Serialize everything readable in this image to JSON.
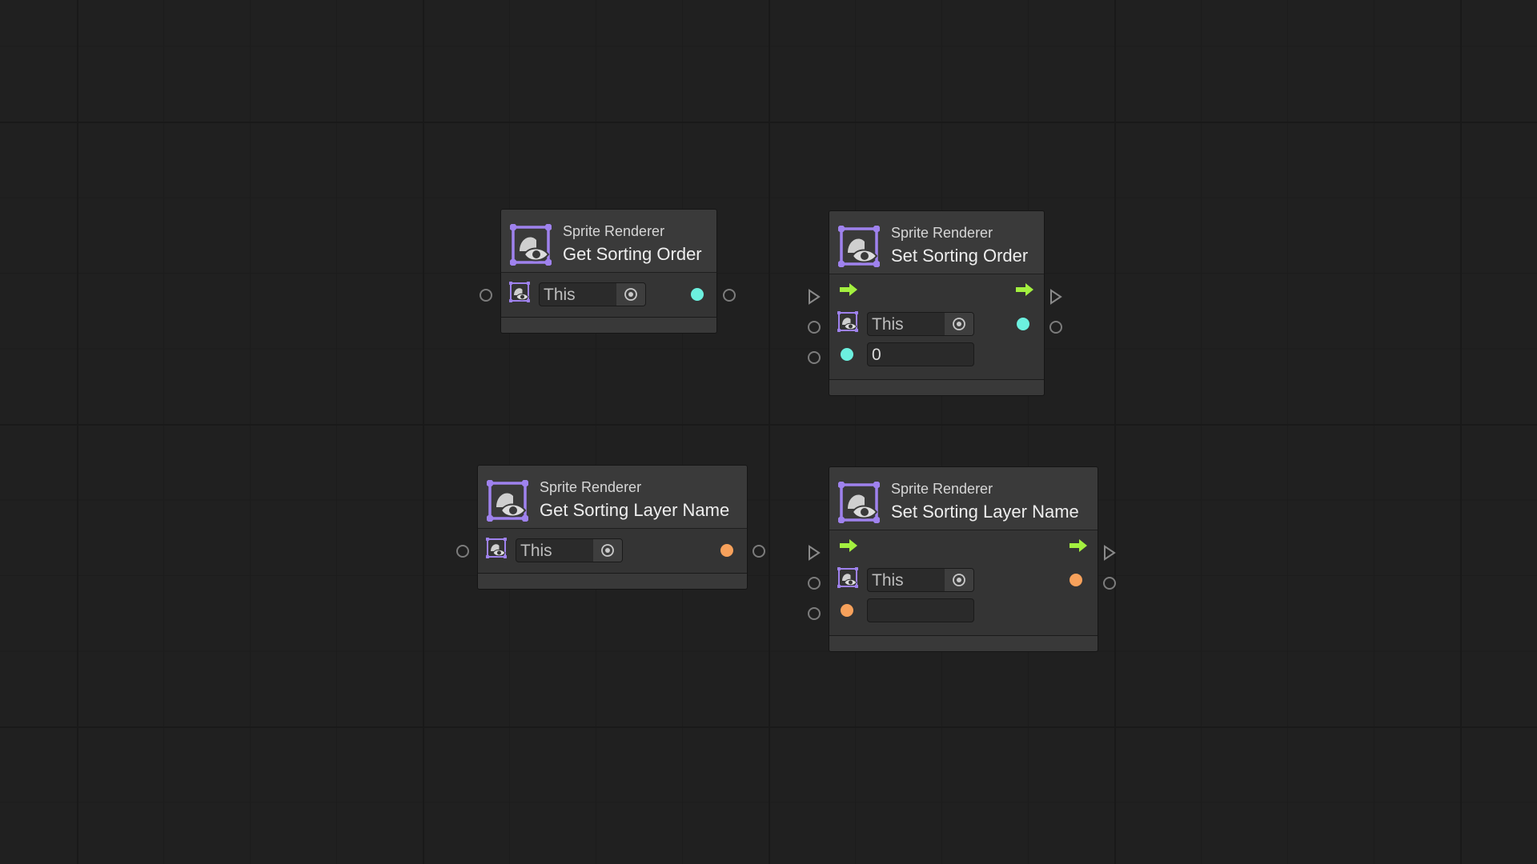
{
  "colors": {
    "background": "#202020",
    "int_port": "#6cf0df",
    "string_port": "#f7a15b",
    "flow_arrow": "#a3f03f",
    "sprite_icon": "#9f82ee"
  },
  "icons": {
    "node_icon": "sprite-renderer-icon",
    "flow": "flow-arrow-icon",
    "picker": "object-picker-icon"
  },
  "nodes": {
    "get_sorting_order": {
      "category": "Sprite Renderer",
      "title": "Get Sorting Order",
      "target": "This",
      "output_type": "int"
    },
    "set_sorting_order": {
      "category": "Sprite Renderer",
      "title": "Set Sorting Order",
      "target": "This",
      "value": "0",
      "output_type": "int"
    },
    "get_sorting_layer_name": {
      "category": "Sprite Renderer",
      "title": "Get Sorting Layer Name",
      "target": "This",
      "output_type": "string"
    },
    "set_sorting_layer_name": {
      "category": "Sprite Renderer",
      "title": "Set Sorting Layer Name",
      "target": "This",
      "value": "",
      "output_type": "string"
    }
  }
}
